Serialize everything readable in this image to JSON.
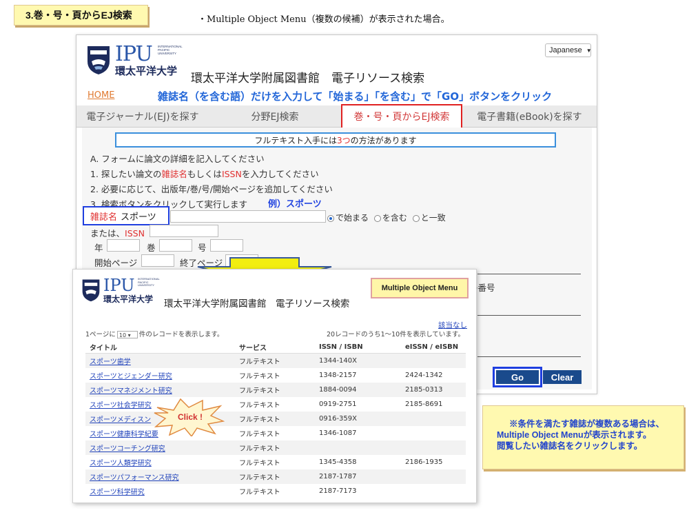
{
  "header": {
    "step_tag": "3.巻・号・頁からEJ検索",
    "caption": "・Multiple Object Menu（複数の候補）が表示された場合。"
  },
  "main": {
    "language": "Japanese",
    "logo": {
      "ipu": "IPU",
      "intl": [
        "INTERNATIONAL",
        "PACIFIC",
        "UNIVERSITY"
      ],
      "jp": "環太平洋大学"
    },
    "site_title": "環太平洋大学附属図書館　電子リソース検索",
    "home_link": "HOME",
    "instruction": "雑誌名（を含む語）だけを入力して「始まる」「を含む」で「GO」ボタンをクリック",
    "tabs": [
      {
        "label": "電子ジャーナル(EJ)を探す"
      },
      {
        "label": "分野EJ検索"
      },
      {
        "label": "巻・号・頁からEJ検索"
      },
      {
        "label": "電子書籍(eBook)を探す"
      }
    ],
    "info": {
      "before": "フルテキスト入手には",
      "num": "3つ",
      "after": "の方法があります"
    },
    "step_a": "A. フォームに論文の詳細を記入してください",
    "step1": {
      "a": "1. 探したい論文の",
      "b": "雑誌名",
      "c": "もしくは",
      "d": "ISSN",
      "e": "を入力してください"
    },
    "step2": "2. 必要に応じて、出版年/巻/号/開始ページを追加してください",
    "step3": "3. 検索ボタンをクリックして実行します",
    "example": "例）スポーツ",
    "field_label": "雑誌名",
    "field_value": "スポーツ",
    "radios": [
      "で始まる",
      "を含む",
      "と一致"
    ],
    "issn_or": "または、",
    "issn_label": "ISSN",
    "year": "年",
    "volume": "巻",
    "issue": "号",
    "start_page": "開始ページ",
    "end_page": "終了ページ",
    "partial_number": "の番号",
    "go": "Go",
    "clear": "Clear"
  },
  "overlay": {
    "logo": {
      "ipu": "IPU",
      "intl": [
        "INTERNATIONAL",
        "PACIFIC",
        "UNIVERSITY"
      ],
      "jp": "環太平洋大学"
    },
    "title": "環太平洋大学附属図書館　電子リソース検索",
    "badge": "Multiple Object Menu",
    "no_match": "該当なし",
    "per_page_prefix": "1ページに",
    "per_page_value": "10",
    "per_page_suffix": "件のレコードを表示します。",
    "count": "20レコードのうち1～10件を表示しています。",
    "columns": [
      "タイトル",
      "サービス",
      "ISSN / ISBN",
      "eISSN / eISBN"
    ],
    "rows": [
      [
        "スポーツ歯学",
        "フルテキスト",
        "1344-140X",
        ""
      ],
      [
        "スポーツとジェンダー研究",
        "フルテキスト",
        "1348-2157",
        "2424-1342"
      ],
      [
        "スポーツマネジメント研究",
        "フルテキスト",
        "1884-0094",
        "2185-0313"
      ],
      [
        "スポーツ社会学研究",
        "フルテキスト",
        "0919-2751",
        "2185-8691"
      ],
      [
        "スポーツメディスン",
        "フルテキスト",
        "0916-359X",
        ""
      ],
      [
        "スポーツ健康科学紀要",
        "フルテキスト",
        "1346-1087",
        ""
      ],
      [
        "スポーツコーチング研究",
        "フルテキスト",
        "",
        ""
      ],
      [
        "スポーツ人類学研究",
        "フルテキスト",
        "1345-4358",
        "2186-1935"
      ],
      [
        "スポーツパフォーマンス研究",
        "フルテキスト",
        "2187-1787",
        ""
      ],
      [
        "スポーツ科学研究",
        "フルテキスト",
        "2187-7173",
        ""
      ]
    ]
  },
  "callout": "Click !",
  "note": [
    "※条件を満たす雑誌が複数ある場合は、",
    "Multiple Object Menuが表示されます。",
    "閲覧したい雑誌名をクリックします。"
  ],
  "colors": {
    "accent_blue": "#2266d8",
    "highlight_red": "#e02020",
    "note_yellow": "#fff9b0",
    "button_navy": "#1a4a8c"
  }
}
